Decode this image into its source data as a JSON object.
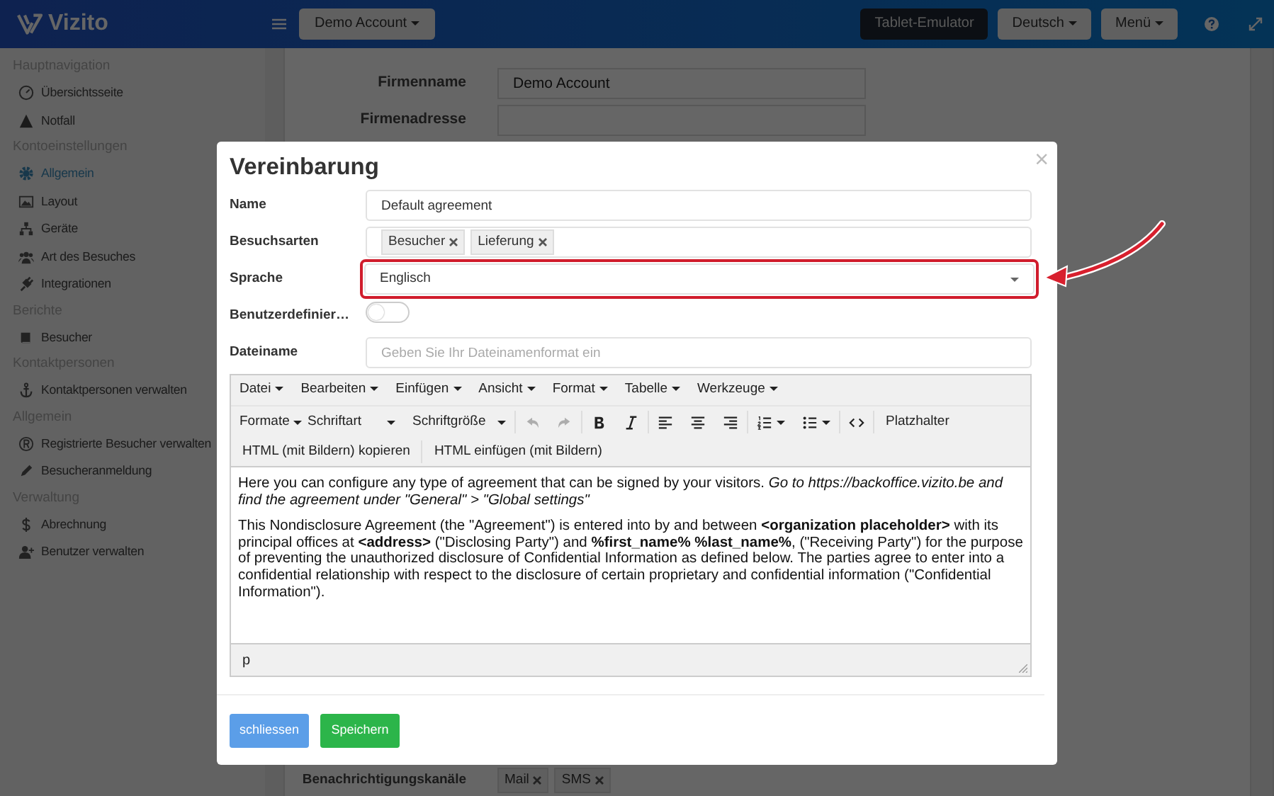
{
  "navbar": {
    "brand": "Vizito",
    "account_button": "Demo Account",
    "buttons": [
      {
        "label": "Tablet-Emulator",
        "kind": "dark"
      },
      {
        "label": "Deutsch",
        "kind": "dropdown"
      },
      {
        "label": "Menü",
        "kind": "dropdown"
      }
    ]
  },
  "sidebar": {
    "sections": [
      {
        "title": "Hauptnavigation",
        "items": [
          {
            "label": "Übersichtsseite",
            "selected": false
          },
          {
            "label": "Notfall",
            "selected": false
          }
        ]
      },
      {
        "title": "Kontoeinstellungen",
        "items": [
          {
            "label": "Allgemein",
            "selected": true
          },
          {
            "label": "Layout",
            "selected": false
          },
          {
            "label": "Geräte",
            "selected": false
          },
          {
            "label": "Art des Besuches",
            "selected": false
          },
          {
            "label": "Integrationen",
            "selected": false
          }
        ]
      },
      {
        "title": "Berichte",
        "items": [
          {
            "label": "Besucher",
            "selected": false
          }
        ]
      },
      {
        "title": "Kontaktpersonen",
        "items": [
          {
            "label": "Kontaktpersonen verwalten",
            "selected": false
          }
        ]
      },
      {
        "title": "Allgemein",
        "items": [
          {
            "label": "Registrierte Besucher verwalten",
            "selected": false
          },
          {
            "label": "Besucheranmeldung",
            "selected": false
          }
        ]
      },
      {
        "title": "Verwaltung",
        "items": [
          {
            "label": "Abrechnung",
            "selected": false
          },
          {
            "label": "Benutzer verwalten",
            "selected": false
          }
        ]
      }
    ]
  },
  "settings_form": {
    "fields": [
      {
        "label": "Firmenname",
        "value": "Demo Account"
      },
      {
        "label": "Firmenadresse"
      }
    ],
    "channels": {
      "label": "Benachrichtigungskanäle",
      "tags": [
        "Mail",
        "SMS"
      ]
    }
  },
  "modal": {
    "title": "Vereinbarung",
    "close": "×",
    "fields": [
      {
        "kind": "text",
        "label": "Name",
        "value": "Default agreement"
      },
      {
        "kind": "tags",
        "label": "Besuchsarten",
        "tags": [
          "Besucher",
          "Lieferung"
        ]
      },
      {
        "kind": "select",
        "label": "Sprache",
        "value": "Englisch",
        "highlighted": true
      },
      {
        "kind": "toggle",
        "label": "Benutzerdefinier…",
        "on": false
      },
      {
        "kind": "text",
        "label": "Dateiname",
        "placeholder": "Geben Sie Ihr Dateinamenformat ein"
      }
    ],
    "editor": {
      "menu": [
        "Datei",
        "Bearbeiten",
        "Einfügen",
        "Ansicht",
        "Format",
        "Tabelle",
        "Werkzeuge"
      ],
      "dropdowns": [
        "Formate",
        "Schriftart",
        "Schriftgröße"
      ],
      "undo": {
        "disabled": true
      },
      "redo": {
        "disabled": true
      },
      "placeholder_button": "Platzhalter",
      "html_buttons": [
        "HTML (mit Bildern) kopieren",
        "HTML einfügen (mit Bildern)"
      ],
      "paragraphs": [
        "Here you can configure any type of agreement that can be signed by your visitors. *Go to https://backoffice.vizito.be and find the agreement under \"General\" > \"Global settings\"*",
        "This Nondisclosure Agreement (the \"Agreement\") is entered into by and between **<organization placeholder>** with its principal offices at **<address>** (\"Disclosing Party\") and **%first_name% %last_name%**, (\"Receiving Party\") for the purpose of preventing the unauthorized disclosure of Confidential Information as defined below. The parties agree to enter into a confidential relationship with respect to the disclosure of certain proprietary and confidential information (\"Confidential Information\")."
      ],
      "status": "p"
    },
    "buttons": [
      {
        "label": "schliessen",
        "kind": "primary"
      },
      {
        "label": "Speichern",
        "kind": "success"
      }
    ]
  }
}
